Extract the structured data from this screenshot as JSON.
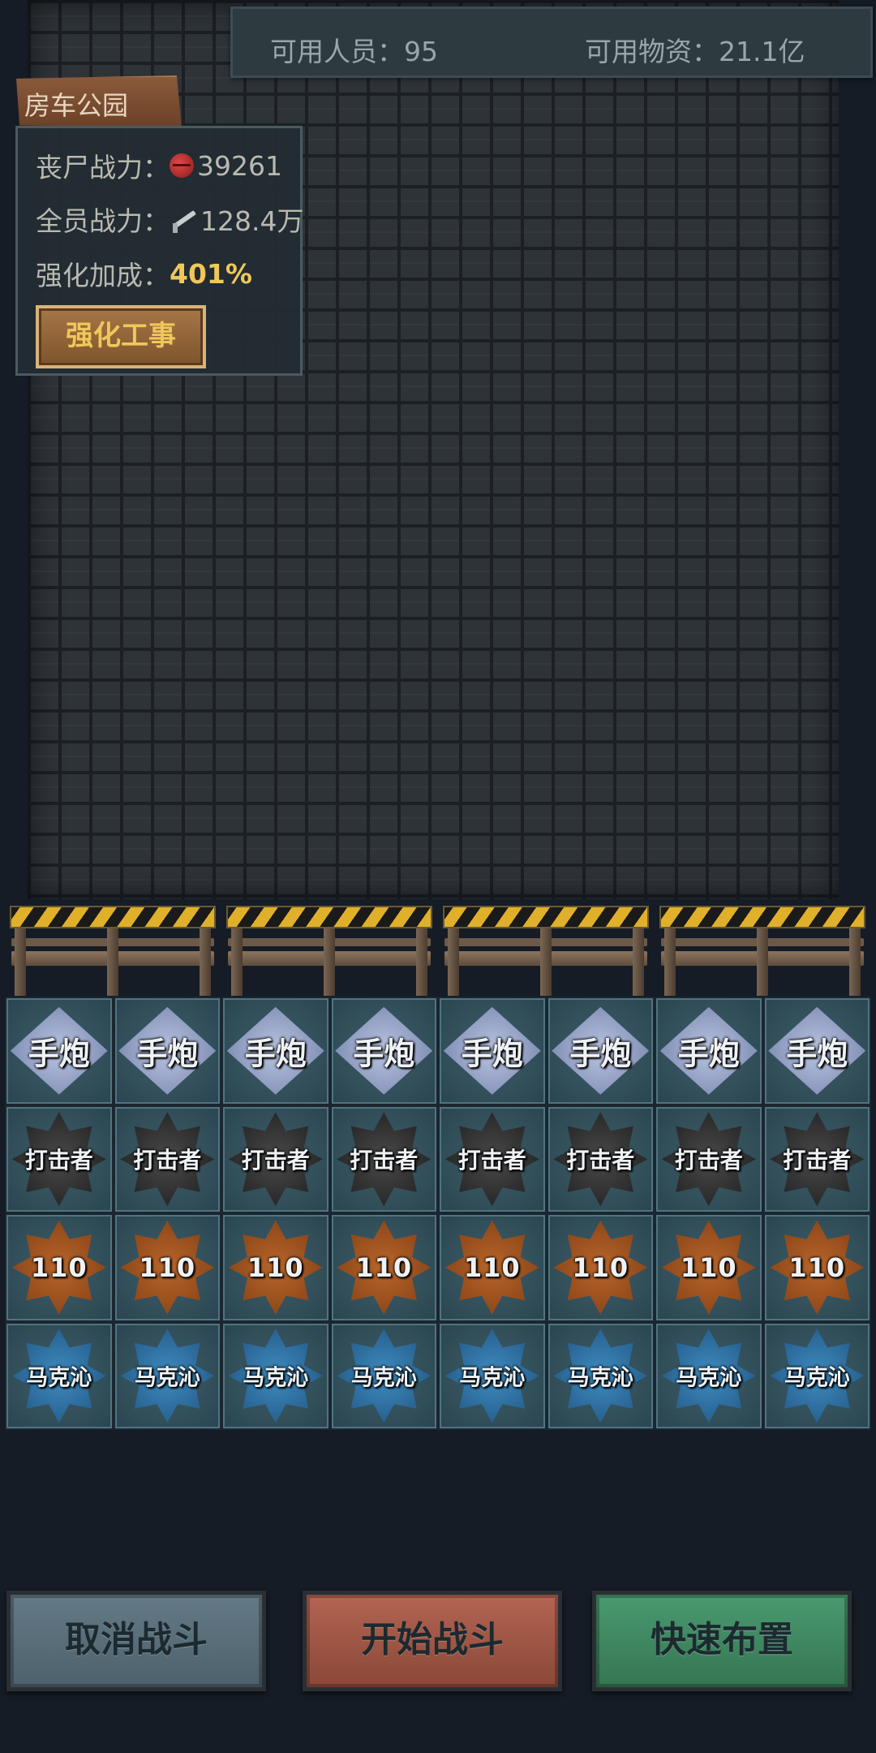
{
  "resources": {
    "personnel_label": "可用人员：",
    "personnel_value": "95",
    "supplies_label": "可用物资：",
    "supplies_value": "21.1亿"
  },
  "location": {
    "name": "房车公园"
  },
  "info_panel": {
    "zombie_power_label": "丧尸战力：",
    "zombie_power_value": "39261",
    "zombie_icon": "zombie-head-icon",
    "team_power_label": "全员战力：",
    "team_power_value": "128.4万",
    "team_icon": "rifle-icon",
    "bonus_label": "强化加成：",
    "bonus_value": "401%",
    "reinforce_button": "强化工事"
  },
  "barricade_count": 4,
  "unit_grid": {
    "rows": [
      {
        "style": "silver",
        "label": "手炮",
        "count": 8
      },
      {
        "style": "black",
        "label": "打击者",
        "count": 8
      },
      {
        "style": "orange",
        "label": "110",
        "count": 8
      },
      {
        "style": "blue",
        "label": "马克沁",
        "count": 8
      }
    ]
  },
  "buttons": {
    "cancel": "取消战斗",
    "start": "开始战斗",
    "quick": "快速布置"
  },
  "colors": {
    "gold_accent": "#f0c75a",
    "cancel_button": "#5a6e79",
    "start_button": "#a05a48",
    "quick_button": "#428a64"
  }
}
